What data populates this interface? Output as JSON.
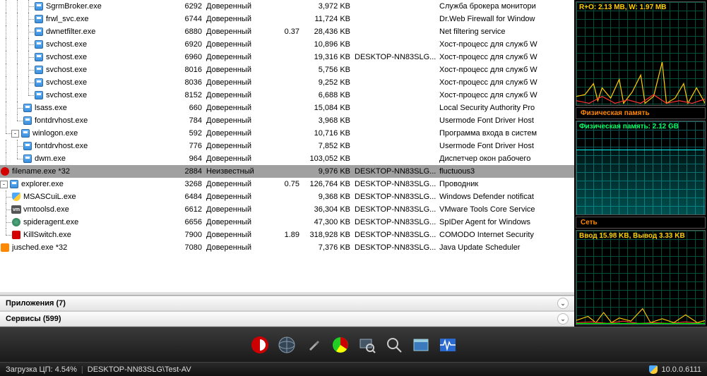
{
  "columns": {
    "kb_suffix": "KB"
  },
  "rating": {
    "trusted": "Доверенный",
    "unknown": "Неизвестный"
  },
  "processes": [
    {
      "indent": 3,
      "branch": "mid",
      "icon": "app",
      "name": "SgrmBroker.exe",
      "pid": 6292,
      "rating": "trusted",
      "cpu": "",
      "mem": "3,972",
      "user": "",
      "desc": "Служба брокера монитори"
    },
    {
      "indent": 3,
      "branch": "mid",
      "icon": "app",
      "name": "frwl_svc.exe",
      "pid": 6744,
      "rating": "trusted",
      "cpu": "",
      "mem": "11,724",
      "user": "",
      "desc": "Dr.Web Firewall for Window"
    },
    {
      "indent": 3,
      "branch": "mid",
      "icon": "app",
      "name": "dwnetfilter.exe",
      "pid": 6880,
      "rating": "trusted",
      "cpu": "0.37",
      "mem": "28,436",
      "user": "",
      "desc": "Net filtering service"
    },
    {
      "indent": 3,
      "branch": "mid",
      "icon": "app",
      "name": "svchost.exe",
      "pid": 6920,
      "rating": "trusted",
      "cpu": "",
      "mem": "10,896",
      "user": "",
      "desc": "Хост-процесс для служб W"
    },
    {
      "indent": 3,
      "branch": "mid",
      "icon": "app",
      "name": "svchost.exe",
      "pid": 6960,
      "rating": "trusted",
      "cpu": "",
      "mem": "19,316",
      "user": "DESKTOP-NN83SLG...",
      "desc": "Хост-процесс для служб W"
    },
    {
      "indent": 3,
      "branch": "mid",
      "icon": "app",
      "name": "svchost.exe",
      "pid": 8016,
      "rating": "trusted",
      "cpu": "",
      "mem": "5,756",
      "user": "",
      "desc": "Хост-процесс для служб W"
    },
    {
      "indent": 3,
      "branch": "mid",
      "icon": "app",
      "name": "svchost.exe",
      "pid": 8036,
      "rating": "trusted",
      "cpu": "",
      "mem": "9,252",
      "user": "",
      "desc": "Хост-процесс для служб W"
    },
    {
      "indent": 3,
      "branch": "last",
      "icon": "app",
      "name": "svchost.exe",
      "pid": 8152,
      "rating": "trusted",
      "cpu": "",
      "mem": "6,688",
      "user": "",
      "desc": "Хост-процесс для служб W"
    },
    {
      "indent": 2,
      "branch": "mid",
      "icon": "app",
      "name": "lsass.exe",
      "pid": 660,
      "rating": "trusted",
      "cpu": "",
      "mem": "15,084",
      "user": "",
      "desc": "Local Security Authority Pro"
    },
    {
      "indent": 2,
      "branch": "last",
      "icon": "app",
      "name": "fontdrvhost.exe",
      "pid": 784,
      "rating": "trusted",
      "cpu": "",
      "mem": "3,968",
      "user": "",
      "desc": "Usermode Font Driver Host"
    },
    {
      "indent": 1,
      "branch": "last",
      "icon": "app",
      "name": "winlogon.exe",
      "expander": "-",
      "pid": 592,
      "rating": "trusted",
      "cpu": "",
      "mem": "10,716",
      "user": "",
      "desc": "Программа входа в систем"
    },
    {
      "indent": 2,
      "branch": "mid",
      "icon": "app",
      "name": "fontdrvhost.exe",
      "pid": 776,
      "rating": "trusted",
      "cpu": "",
      "mem": "7,852",
      "user": "",
      "desc": "Usermode Font Driver Host"
    },
    {
      "indent": 2,
      "branch": "last",
      "icon": "app",
      "name": "dwm.exe",
      "pid": 964,
      "rating": "trusted",
      "cpu": "",
      "mem": "103,052",
      "user": "",
      "desc": "Диспетчер окон рабочего",
      "lastInGroup": true
    },
    {
      "indent": 0,
      "branch": "",
      "icon": "bug",
      "name": "filename.exe *32",
      "pid": 2884,
      "rating": "unknown",
      "cpu": "",
      "mem": "9,976",
      "user": "DESKTOP-NN83SLG...",
      "desc": "fluctuous3",
      "selected": true
    },
    {
      "indent": 0,
      "branch": "",
      "icon": "app",
      "name": "explorer.exe",
      "expander": "-",
      "pid": 3268,
      "rating": "trusted",
      "cpu": "0.75",
      "mem": "126,764",
      "user": "DESKTOP-NN83SLG...",
      "desc": "Проводник"
    },
    {
      "indent": 1,
      "branch": "mid",
      "icon": "shield",
      "name": "MSASCuiL.exe",
      "pid": 6484,
      "rating": "trusted",
      "cpu": "",
      "mem": "9,368",
      "user": "DESKTOP-NN83SLG...",
      "desc": "Windows Defender notificat"
    },
    {
      "indent": 1,
      "branch": "mid",
      "icon": "vm",
      "name": "vmtoolsd.exe",
      "pid": 6612,
      "rating": "trusted",
      "cpu": "",
      "mem": "36,304",
      "user": "DESKTOP-NN83SLG...",
      "desc": "VMware Tools Core Service"
    },
    {
      "indent": 1,
      "branch": "mid",
      "icon": "spider",
      "name": "spideragent.exe",
      "pid": 6656,
      "rating": "trusted",
      "cpu": "",
      "mem": "47,300",
      "user": "DESKTOP-NN83SLG...",
      "desc": "SpIDer Agent for Windows"
    },
    {
      "indent": 1,
      "branch": "last",
      "icon": "comodo",
      "name": "KillSwitch.exe",
      "pid": 7900,
      "rating": "trusted",
      "cpu": "1.89",
      "mem": "318,928",
      "user": "DESKTOP-NN83SLG...",
      "desc": "COMODO Internet Security"
    },
    {
      "indent": 0,
      "branch": "",
      "icon": "java",
      "name": "jusched.exe *32",
      "pid": 7080,
      "rating": "trusted",
      "cpu": "",
      "mem": "7,376",
      "user": "DESKTOP-NN83SLG...",
      "desc": "Java Update Scheduler"
    }
  ],
  "sections": {
    "apps": "Приложения (7)",
    "services": "Сервисы (599)"
  },
  "graphs": {
    "disk_label": "R+O: 2.13 MB, W: 1.97 MB",
    "disk_label_color": "#ffcc00",
    "mem_title": "Физическая память",
    "mem_label": "Физическая память: 2.12 GB",
    "mem_label_color": "#00ff66",
    "net_title": "Сеть",
    "net_label": "Ввод 15.98 KB, Вывод 3.33 KB",
    "net_label_color": "#ffcc00"
  },
  "statusbar": {
    "cpu": "Загрузка ЦП: 4.54%",
    "host": "DESKTOP-NN83SLG\\Test-AV",
    "version": "10.0.0.6111"
  }
}
